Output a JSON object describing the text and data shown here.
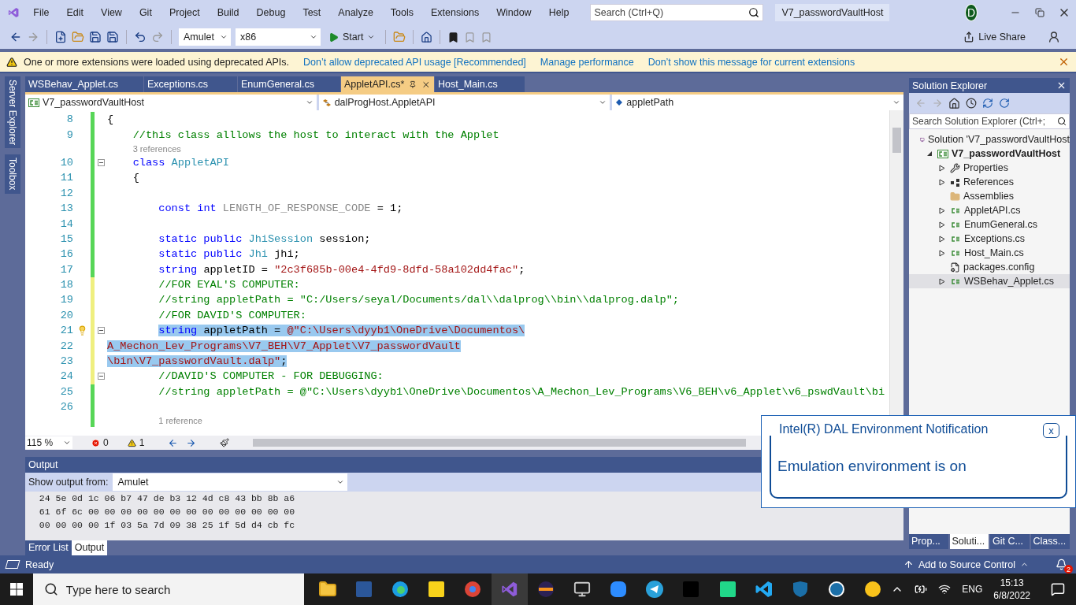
{
  "menu": [
    "File",
    "Edit",
    "View",
    "Git",
    "Project",
    "Build",
    "Debug",
    "Test",
    "Analyze",
    "Tools",
    "Extensions",
    "Window",
    "Help"
  ],
  "search": {
    "placeholder": "Search (Ctrl+Q)"
  },
  "solution_name": "V7_passwordVaultHost",
  "account": {
    "initial": "D"
  },
  "toolbar": {
    "configuration": "Amulet",
    "platform": "x86",
    "start": "Start",
    "live_share": "Live Share"
  },
  "infobar": {
    "message": "One or more extensions were loaded using deprecated APIs.",
    "links": [
      "Don’t allow deprecated API usage [Recommended]",
      "Manage performance",
      "Don’t show this message for current extensions"
    ]
  },
  "side_tabs": [
    "Server Explorer",
    "Toolbox"
  ],
  "editor": {
    "tabs": [
      {
        "label": "WSBehav_Applet.cs",
        "selected": false
      },
      {
        "label": "Exceptions.cs",
        "selected": false
      },
      {
        "label": "EnumGeneral.cs",
        "selected": false
      },
      {
        "label": "AppletAPI.cs*",
        "selected": true
      },
      {
        "label": "Host_Main.cs",
        "selected": false
      }
    ],
    "navigation": [
      {
        "kind": "project",
        "label": "V7_passwordVaultHost"
      },
      {
        "kind": "class",
        "label": "dalProgHost.AppletAPI"
      },
      {
        "kind": "field",
        "label": "appletPath"
      }
    ],
    "lines": [
      {
        "kind": "code",
        "number": "8",
        "modified": false,
        "selected": false,
        "tokens": [
          {
            "kind": "plain",
            "text": "{"
          }
        ]
      },
      {
        "kind": "code",
        "number": "9",
        "modified": false,
        "selected": false,
        "tokens": [
          {
            "kind": "comment",
            "text": "    //this class alllows the host to interact with the Applet"
          }
        ]
      },
      {
        "kind": "codelens",
        "modified": false,
        "text": "    3 references"
      },
      {
        "kind": "code",
        "number": "10",
        "modified": false,
        "selected": false,
        "collapsible": true,
        "tokens": [
          {
            "kind": "keyword",
            "text": "    class"
          },
          {
            "kind": "type",
            "text": " AppletAPI"
          }
        ]
      },
      {
        "kind": "code",
        "number": "11",
        "modified": false,
        "selected": false,
        "tokens": [
          {
            "kind": "plain",
            "text": "    {"
          }
        ]
      },
      {
        "kind": "code",
        "number": "12",
        "modified": false
      },
      {
        "kind": "code",
        "number": "13",
        "modified": false,
        "selected": false,
        "tokens": [
          {
            "kind": "keyword",
            "text": "        const"
          },
          {
            "kind": "keyword",
            "text": " int"
          },
          {
            "kind": "unused",
            "text": " LENGTH_OF_RESPONSE_CODE"
          },
          {
            "kind": "plain",
            "text": " = 1;"
          }
        ]
      },
      {
        "kind": "code",
        "number": "14",
        "modified": false
      },
      {
        "kind": "code",
        "number": "15",
        "modified": false,
        "selected": false,
        "tokens": [
          {
            "kind": "keyword",
            "text": "        static public"
          },
          {
            "kind": "type",
            "text": " JhiSession"
          },
          {
            "kind": "plain",
            "text": " session;"
          }
        ]
      },
      {
        "kind": "code",
        "number": "16",
        "modified": false,
        "selected": false,
        "tokens": [
          {
            "kind": "keyword",
            "text": "        static public"
          },
          {
            "kind": "type",
            "text": " Jhi"
          },
          {
            "kind": "plain",
            "text": " jhi;"
          }
        ]
      },
      {
        "kind": "code",
        "number": "17",
        "modified": false,
        "selected": false,
        "tokens": [
          {
            "kind": "keyword",
            "text": "        string"
          },
          {
            "kind": "plain",
            "text": " appletID = "
          },
          {
            "kind": "string",
            "text": "\"2c3f685b-00e4-4fd9-8dfd-58a102dd4fac\""
          },
          {
            "kind": "plain",
            "text": ";"
          }
        ]
      },
      {
        "kind": "code",
        "number": "18",
        "modified": true,
        "selected": false,
        "tokens": [
          {
            "kind": "comment",
            "text": "        //FOR EYAL'S COMPUTER:"
          }
        ]
      },
      {
        "kind": "code",
        "number": "19",
        "modified": true,
        "selected": false,
        "tokens": [
          {
            "kind": "comment",
            "text": "        //string appletPath = \"C:/Users/seyal/Documents/dal\\\\dalprog\\\\bin\\\\dalprog.dalp\";"
          }
        ]
      },
      {
        "kind": "code",
        "number": "20",
        "modified": true,
        "selected": false,
        "tokens": [
          {
            "kind": "comment",
            "text": "        //FOR DAVID'S COMPUTER:"
          }
        ]
      },
      {
        "kind": "code",
        "number": "21",
        "modified": true,
        "collapsible": true,
        "lightbulb": true,
        "selected": true,
        "tokens": [
          {
            "kind": "keyword",
            "text": "        string"
          },
          {
            "kind": "plain",
            "text": " appletPath = "
          },
          {
            "kind": "string",
            "text": "@\"C:\\Users\\dyyb1\\OneDrive\\Documentos\\"
          }
        ]
      },
      {
        "kind": "code",
        "number": "22",
        "modified": true,
        "selected": true,
        "tokens": [
          {
            "kind": "string",
            "text": "A_Mechon_Lev_Programs\\V7_BEH\\V7_Applet\\V7_passwordVault"
          }
        ]
      },
      {
        "kind": "code",
        "number": "23",
        "modified": true,
        "selected": true,
        "tokens": [
          {
            "kind": "string",
            "text": "\\bin\\V7_passwordVault.dalp\""
          },
          {
            "kind": "plain",
            "text": ";"
          }
        ]
      },
      {
        "kind": "code",
        "number": "24",
        "modified": true,
        "selected": false,
        "collapsible": true,
        "tokens": [
          {
            "kind": "comment",
            "text": "        //DAVID'S COMPUTER - FOR DEBUGGING:"
          }
        ]
      },
      {
        "kind": "code",
        "number": "25",
        "modified": false,
        "selected": false,
        "tokens": [
          {
            "kind": "comment",
            "text": "        //string appletPath = @\"C:\\Users\\dyyb1\\OneDrive\\Documentos\\A_Mechon_Lev_Programs\\V6_BEH\\v6_Applet\\v6_pswdVault\\bi"
          }
        ]
      },
      {
        "kind": "code",
        "number": "26",
        "modified": false
      },
      {
        "kind": "codelens",
        "modified": false,
        "text": "        1 reference"
      }
    ],
    "zoom": "115 %",
    "errors": "0",
    "warnings": "1"
  },
  "output": {
    "title": "Output",
    "source_label": "Show output from:",
    "source": "Amulet",
    "lines": [
      "  24 5e 0d 1c 06 b7 47 de b3 12 4d c8 43 bb 8b a6",
      "  61 6f 6c 00 00 00 00 00 00 00 00 00 00 00 00 00",
      "  00 00 00 00 1f 03 5a 7d 09 38 25 1f 5d d4 cb fc"
    ]
  },
  "bottom_tabs": [
    {
      "label": "Error List",
      "selected": false
    },
    {
      "label": "Output",
      "selected": true
    }
  ],
  "solution_explorer": {
    "title": "Solution Explorer",
    "search_placeholder": "Search Solution Explorer (Ctrl+;",
    "tree": [
      {
        "kind": "solution",
        "label": "Solution 'V7_passwordVaultHost",
        "selected": false,
        "children": [
          {
            "kind": "project",
            "label": "V7_passwordVaultHost",
            "expanded": true,
            "selected": false,
            "children": [
              {
                "kind": "properties",
                "label": "Properties",
                "expanded": false,
                "selected": false
              },
              {
                "kind": "references",
                "label": "References",
                "expanded": false,
                "selected": false
              },
              {
                "kind": "folder",
                "label": "Assemblies",
                "selected": false
              },
              {
                "kind": "csharp",
                "label": "AppletAPI.cs",
                "expanded": false,
                "selected": false
              },
              {
                "kind": "csharp",
                "label": "EnumGeneral.cs",
                "expanded": false,
                "selected": false
              },
              {
                "kind": "csharp",
                "label": "Exceptions.cs",
                "expanded": false,
                "selected": false
              },
              {
                "kind": "csharp",
                "label": "Host_Main.cs",
                "expanded": false,
                "selected": false
              },
              {
                "kind": "config",
                "label": "packages.config",
                "selected": false
              },
              {
                "kind": "csharp",
                "label": "WSBehav_Applet.cs",
                "expanded": false,
                "selected": true
              }
            ]
          }
        ]
      }
    ],
    "tabs": [
      {
        "label": "Prop...",
        "selected": false
      },
      {
        "label": "Soluti...",
        "selected": true
      },
      {
        "label": "Git C...",
        "selected": false
      },
      {
        "label": "Class...",
        "selected": false
      }
    ]
  },
  "notification": {
    "title": "Intel(R) DAL Environment Notification",
    "close": "x",
    "message": "Emulation environment is on"
  },
  "status": {
    "text": "Ready",
    "source_control": "Add to Source Control",
    "notifications": "2"
  },
  "taskbar": {
    "search_placeholder": "Type here to search",
    "language": "ENG",
    "time": "15:13",
    "date": "6/8/2022"
  }
}
